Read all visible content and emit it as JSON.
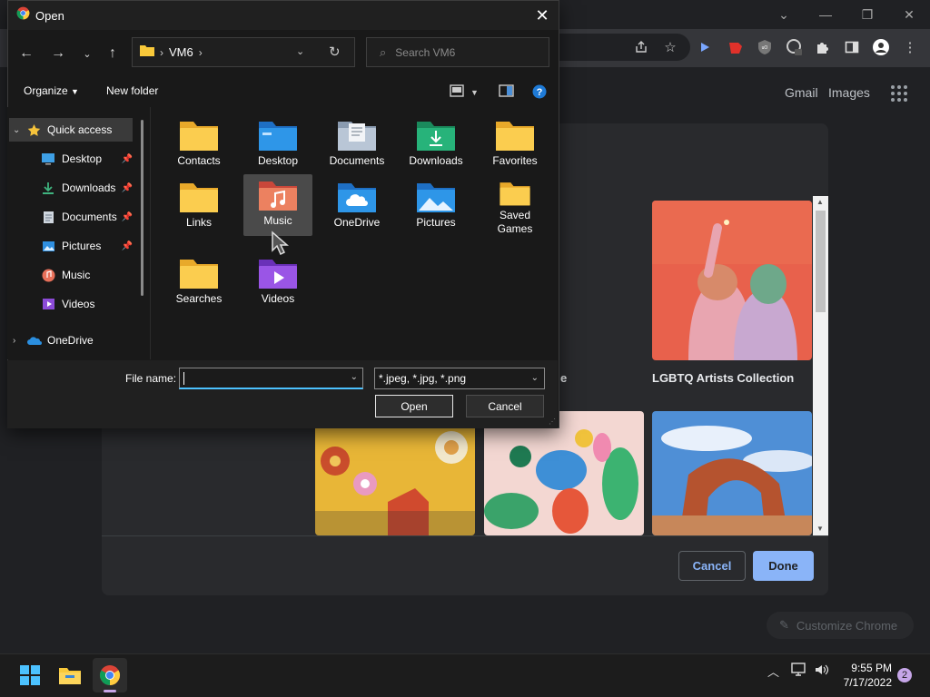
{
  "chrome": {
    "ntp_links": {
      "gmail": "Gmail",
      "images": "Images"
    },
    "window_controls": {
      "minimize": "—",
      "restore": "❐",
      "close": "✕",
      "collapse": "⌄"
    }
  },
  "customize": {
    "tile_labels": {
      "partial": "e",
      "lgbtq": "LGBTQ Artists Collection"
    },
    "cancel": "Cancel",
    "done": "Done",
    "chip": "Customize Chrome"
  },
  "dialog": {
    "title": "Open",
    "breadcrumb": [
      "VM6"
    ],
    "search_placeholder": "Search VM6",
    "organize": "Organize",
    "new_folder": "New folder",
    "nav": [
      {
        "label": "Quick access",
        "icon": "star-icon",
        "selected": true
      },
      {
        "label": "Desktop",
        "icon": "desktop-icon",
        "pinned": true
      },
      {
        "label": "Downloads",
        "icon": "download-icon",
        "pinned": true
      },
      {
        "label": "Documents",
        "icon": "document-icon",
        "pinned": true
      },
      {
        "label": "Pictures",
        "icon": "pictures-icon",
        "pinned": true
      },
      {
        "label": "Music",
        "icon": "music-icon"
      },
      {
        "label": "Videos",
        "icon": "videos-icon"
      },
      {
        "label": "OneDrive",
        "icon": "onedrive-icon"
      }
    ],
    "files": [
      {
        "label": "Contacts",
        "kind": "folder"
      },
      {
        "label": "Desktop",
        "kind": "desktop"
      },
      {
        "label": "Documents",
        "kind": "documents"
      },
      {
        "label": "Downloads",
        "kind": "downloads"
      },
      {
        "label": "Favorites",
        "kind": "folder"
      },
      {
        "label": "Links",
        "kind": "folder"
      },
      {
        "label": "Music",
        "kind": "music"
      },
      {
        "label": "OneDrive",
        "kind": "onedrive"
      },
      {
        "label": "Pictures",
        "kind": "pictures"
      },
      {
        "label": "Saved Games",
        "kind": "folder"
      },
      {
        "label": "Searches",
        "kind": "folder"
      },
      {
        "label": "Videos",
        "kind": "videos"
      }
    ],
    "file_name_label": "File name:",
    "file_name_value": "",
    "file_type": "*.jpeg, *.jpg, *.png",
    "open": "Open",
    "cancel": "Cancel"
  },
  "taskbar": {
    "time": "9:55 PM",
    "date": "7/17/2022",
    "notifications": "2"
  },
  "colors": {
    "folder_yellow": "#f9c93a",
    "accent_blue": "#4cc2ff",
    "done_blue": "#8ab4f8"
  }
}
